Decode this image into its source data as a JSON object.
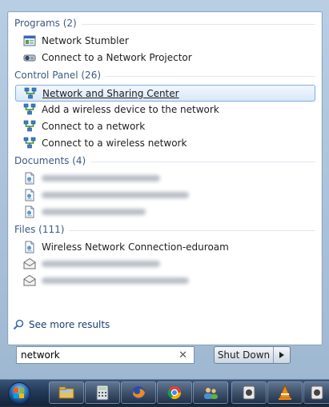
{
  "groups": [
    {
      "header": "Programs (2)",
      "items": [
        {
          "label": "Network Stumbler",
          "icon": "network-stumbler-icon",
          "blurred": false,
          "selected": false
        },
        {
          "label": "Connect to a Network Projector",
          "icon": "projector-icon",
          "blurred": false,
          "selected": false
        }
      ]
    },
    {
      "header": "Control Panel (26)",
      "items": [
        {
          "label": "Network and Sharing Center",
          "icon": "network-icon",
          "blurred": false,
          "selected": true
        },
        {
          "label": "Add a wireless device to the network",
          "icon": "network-icon",
          "blurred": false,
          "selected": false
        },
        {
          "label": "Connect to a network",
          "icon": "network-icon",
          "blurred": false,
          "selected": false
        },
        {
          "label": "Connect to a wireless network",
          "icon": "network-icon",
          "blurred": false,
          "selected": false
        }
      ]
    },
    {
      "header": "Documents (4)",
      "items": [
        {
          "label": "",
          "icon": "document-icon",
          "blurred": true,
          "selected": false
        },
        {
          "label": "",
          "icon": "document-icon",
          "blurred": true,
          "selected": false
        },
        {
          "label": "",
          "icon": "document-icon",
          "blurred": true,
          "selected": false
        }
      ]
    },
    {
      "header": "Files (111)",
      "items": [
        {
          "label": "Wireless Network Connection-eduroam",
          "icon": "document-icon",
          "blurred": false,
          "selected": false
        },
        {
          "label": "",
          "icon": "mail-icon",
          "blurred": true,
          "selected": false
        },
        {
          "label": "",
          "icon": "mail-icon",
          "blurred": true,
          "selected": false
        }
      ]
    }
  ],
  "see_more": "See more results",
  "search": {
    "value": "network"
  },
  "shutdown": {
    "label": "Shut Down"
  },
  "taskbar": {
    "items": [
      "explorer-icon",
      "calculator-icon",
      "firefox-icon",
      "chrome-icon",
      "users-icon",
      "app-icon",
      "vlc-icon",
      "app-icon"
    ]
  },
  "colors": {
    "header": "#3d5a84",
    "link": "#1c3d74",
    "selection_border": "#84acdd"
  }
}
